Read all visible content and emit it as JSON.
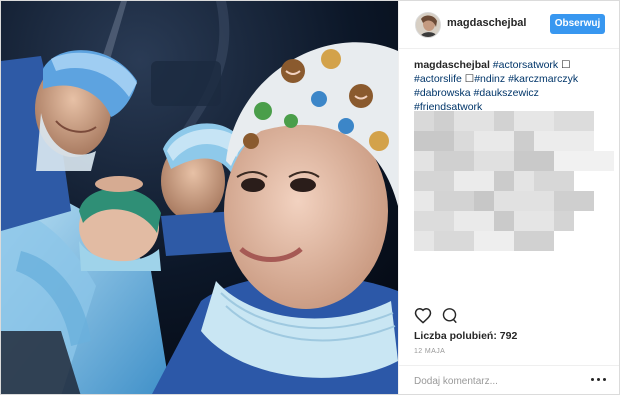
{
  "header": {
    "username": "magdaschejbal",
    "follow_label": "Obserwuj"
  },
  "caption": {
    "username": "magdaschejbal",
    "line1_tag": "#actorsatwork",
    "line1_box": "☐",
    "line2_tag1": "#actorslife",
    "line2_box": "☐",
    "line2_tag2": "#ndinz",
    "line2_tag3": "#karczmarczyk",
    "line3_tag1": "#dabrowska",
    "line3_tag2": "#daukszewicz",
    "line4_tag": "#friendsatwork"
  },
  "actions": {
    "like_icon": "heart-icon",
    "comment_icon": "speech-bubble-icon"
  },
  "likes": {
    "label": "Liczba polubień:",
    "count": "792"
  },
  "date": "12 MAJA",
  "comment": {
    "placeholder": "Dodaj komentarz..."
  },
  "colors": {
    "follow_button": "#3897f0",
    "hashtag": "#003569",
    "border": "#efefef"
  }
}
